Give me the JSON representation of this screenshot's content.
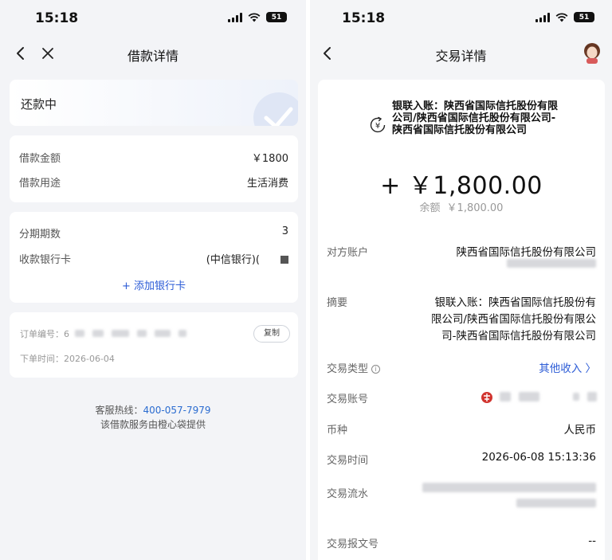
{
  "left": {
    "status_bar": {
      "time": "15:18",
      "battery": "51"
    },
    "nav": {
      "title": "借款详情"
    },
    "loan_status": "还款中",
    "amount_card": {
      "amount_label": "借款金额",
      "amount_value": "￥1800",
      "purpose_label": "借款用途",
      "purpose_value": "生活消费"
    },
    "installment_card": {
      "periods_label": "分期期数",
      "periods_value": "3",
      "bank_label": "收款银行卡",
      "bank_value": "(中信银行)(",
      "add_card": "+ 添加银行卡"
    },
    "order_card": {
      "order_no_label": "订单编号：6",
      "copy": "复制",
      "order_time": "下单时间：2026-06-04"
    },
    "footer": {
      "hotline_label": "客服热线：",
      "hotline": "400-057-7979",
      "provider": "该借款服务由橙心袋提供"
    }
  },
  "right": {
    "status_bar": {
      "time": "15:18",
      "battery": "51"
    },
    "nav": {
      "title": "交易详情"
    },
    "merchant": "银联入账：陕西省国际信托股份有限公司/陕西省国际信托股份有限公司-陕西省国际信托股份有限公司",
    "amount": "+ ￥1,800.00",
    "balance_label": "余额",
    "balance_value": "￥1,800.00",
    "details": {
      "counterparty_label": "对方账户",
      "counterparty_value": "陕西省国际信托股份有限公司",
      "summary_label": "摘要",
      "summary_line1": "银联入账：陕西省国际信托股份有",
      "summary_line2": "限公司/陕西省国际信托股份有限公",
      "summary_line3": "司-陕西省国际信托股份有限公司",
      "type_label": "交易类型",
      "type_value": "其他收入 〉",
      "account_label": "交易账号",
      "currency_label": "币种",
      "currency_value": "人民币",
      "time_label": "交易时间",
      "time_value": "2026-06-08 15:13:36",
      "serial_label": "交易流水",
      "msg_label": "交易报文号",
      "msg_value": "--"
    }
  }
}
